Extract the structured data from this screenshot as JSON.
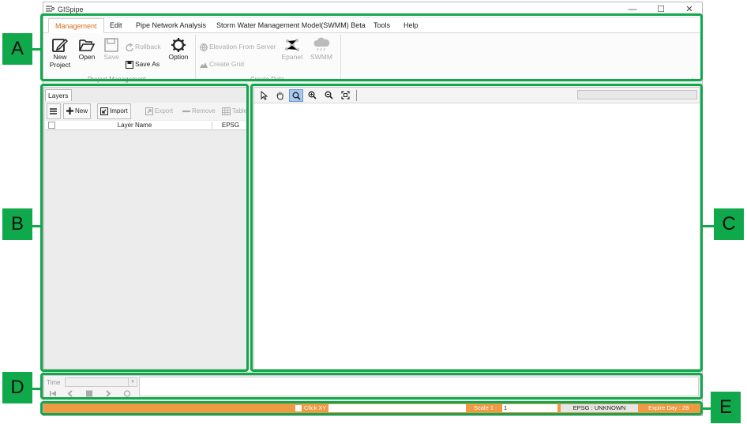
{
  "window": {
    "title": "GISpipe",
    "controls": {
      "minimize": "—",
      "maximize": "☐",
      "close": "✕"
    }
  },
  "menu": {
    "tabs": [
      {
        "label": "Management",
        "active": true
      },
      {
        "label": "Edit"
      },
      {
        "label": "Pipe Network Analysis"
      },
      {
        "label": "Storm Water Management Model(SWMM) Beta"
      },
      {
        "label": "Tools"
      },
      {
        "label": "Help"
      }
    ]
  },
  "ribbon": {
    "groups": [
      {
        "label": "Project Management",
        "buttons": {
          "new_project_line1": "New",
          "new_project_line2": "Project",
          "open": "Open",
          "save": "Save",
          "rollback": "Rollback",
          "save_as": "Save As",
          "option": "Option"
        }
      },
      {
        "label": "Create Data",
        "buttons": {
          "elevation": "Elevation From Server",
          "create_grid": "Create Grid",
          "epanet": "Epanet",
          "swmm": "SWMM"
        }
      }
    ],
    "collapse_icon": "chevron-up-icon"
  },
  "layers_panel": {
    "tab": "Layers",
    "toolbar": {
      "menu_icon": "hamburger-icon",
      "new": "New",
      "import": "Import",
      "export": "Export",
      "remove": "Remove",
      "table": "Table"
    },
    "columns": [
      "Layer Name",
      "EPSG"
    ],
    "rows": []
  },
  "map_panel": {
    "tools": [
      "select-arrow-icon",
      "pan-hand-icon",
      "zoom-icon",
      "zoom-in-icon",
      "zoom-out-icon",
      "zoom-extent-icon"
    ],
    "active_tool": "zoom-icon"
  },
  "time_panel": {
    "label": "Time",
    "selected": ""
  },
  "status_bar": {
    "click_xy": "Click XY",
    "scale_label": "Scale  1 :",
    "scale_value": "1",
    "epsg": "EPSG : UNKNOWN",
    "expire": "Expire Day : 28",
    "color": "#ee9944"
  },
  "annotations": [
    "A",
    "B",
    "C",
    "D",
    "E"
  ],
  "colors": {
    "highlight": "#0fa84a",
    "active_tab": "#d66f1e"
  }
}
